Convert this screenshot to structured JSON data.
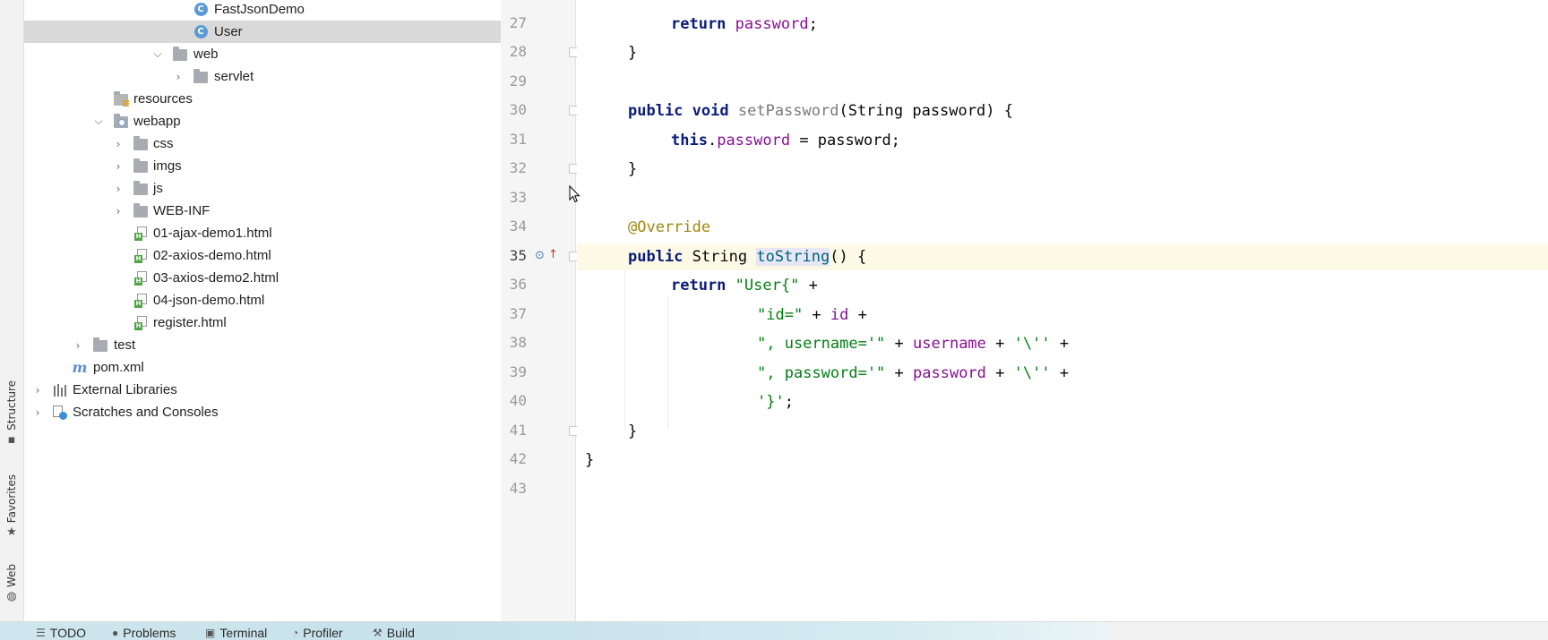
{
  "left_strip": {
    "structure_label": "Structure",
    "favorites_label": "Favorites",
    "web_label": "Web"
  },
  "project_tree": {
    "items": [
      {
        "label": "FastJsonDemo",
        "icon": "class-icon"
      },
      {
        "label": "User",
        "icon": "class-icon",
        "selected": true
      },
      {
        "label": "web",
        "icon": "package-folder-icon",
        "expanded": true
      },
      {
        "label": "servlet",
        "icon": "package-folder-icon",
        "expanded": false
      },
      {
        "label": "resources",
        "icon": "resources-folder-icon"
      },
      {
        "label": "webapp",
        "icon": "web-folder-icon",
        "expanded": true
      },
      {
        "label": "css",
        "icon": "folder-icon",
        "expanded": false
      },
      {
        "label": "imgs",
        "icon": "folder-icon",
        "expanded": false
      },
      {
        "label": "js",
        "icon": "folder-icon",
        "expanded": false
      },
      {
        "label": "WEB-INF",
        "icon": "folder-icon",
        "expanded": false
      },
      {
        "label": "01-ajax-demo1.html",
        "icon": "html-file-icon"
      },
      {
        "label": "02-axios-demo.html",
        "icon": "html-file-icon"
      },
      {
        "label": "03-axios-demo2.html",
        "icon": "html-file-icon"
      },
      {
        "label": "04-json-demo.html",
        "icon": "html-file-icon"
      },
      {
        "label": "register.html",
        "icon": "html-file-icon"
      },
      {
        "label": "test",
        "icon": "folder-icon",
        "expanded": false
      },
      {
        "label": "pom.xml",
        "icon": "maven-icon"
      },
      {
        "label": "External Libraries",
        "icon": "libraries-icon",
        "expanded": false
      },
      {
        "label": "Scratches and Consoles",
        "icon": "scratches-icon",
        "expanded": false
      }
    ]
  },
  "editor": {
    "line_numbers": [
      "27",
      "28",
      "29",
      "30",
      "31",
      "32",
      "33",
      "34",
      "35",
      "36",
      "37",
      "38",
      "39",
      "40",
      "41",
      "42",
      "43"
    ],
    "current_line": "35",
    "code": {
      "l27_return": "return",
      "l27_field": "password",
      "l27_end": ";",
      "l28": "}",
      "l30_public": "public",
      "l30_void": "void",
      "l30_name": "setPassword",
      "l30_params": "(String password) {",
      "l31_this": "this",
      "l31_dot": ".",
      "l31_field": "password",
      "l31_rest": " = password;",
      "l32": "}",
      "l34_ann": "@Override",
      "l35_public": "public",
      "l35_type": "String",
      "l35_name": "toString",
      "l35_rest": "() {",
      "l36_return": "return",
      "l36_str": "\"User{\"",
      "l36_rest": " +",
      "l37_str": "\"id=\"",
      "l37_plus": " + ",
      "l37_field": "id",
      "l37_rest": " +",
      "l38_str": "\", username='\"",
      "l38_plus": " + ",
      "l38_field": "username",
      "l38_plus2": " + ",
      "l38_char": "'\\''",
      "l38_rest": " +",
      "l39_str": "\", password='\"",
      "l39_plus": " + ",
      "l39_field": "password",
      "l39_plus2": " + ",
      "l39_char": "'\\''",
      "l39_rest": " +",
      "l40_char": "'}'",
      "l40_rest": ";",
      "l41": "}",
      "l42": "}"
    }
  },
  "bottom_bar": {
    "todo": "TODO",
    "problems": "Problems",
    "terminal": "Terminal",
    "profiler": "Profiler",
    "build": "Build"
  },
  "colors": {
    "keyword": "#0b1c7a",
    "string": "#067d17",
    "field": "#871094",
    "annotation": "#9e880d",
    "selection": "#d9d9d9",
    "current_line": "#fcfae6"
  }
}
